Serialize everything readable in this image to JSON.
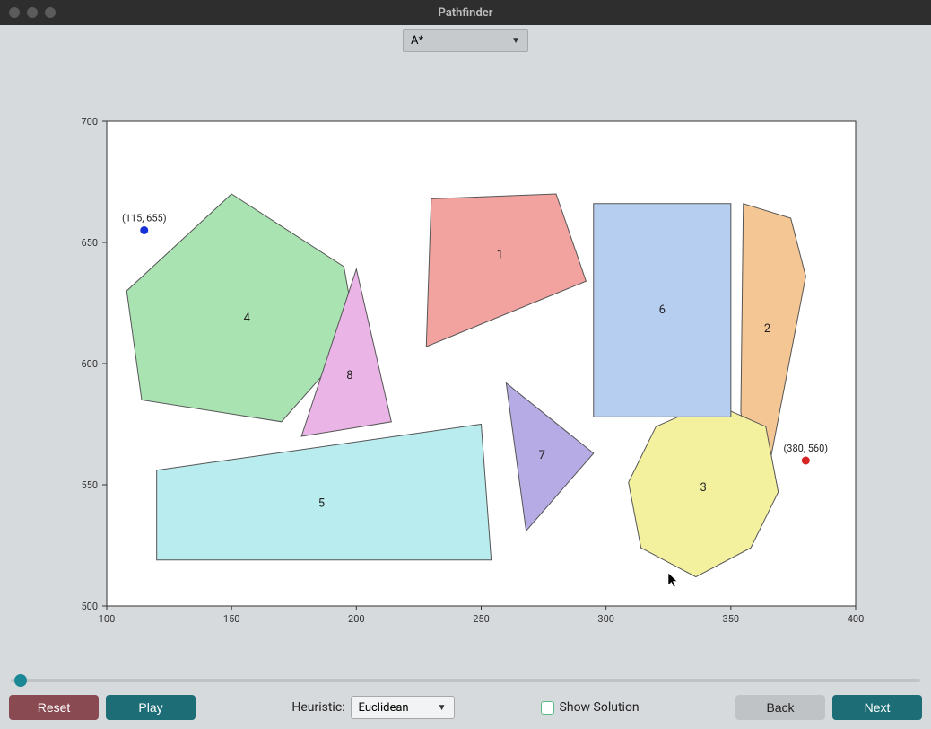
{
  "window": {
    "title": "Pathfinder"
  },
  "toolbar": {
    "algorithm_label": "A*"
  },
  "footer": {
    "reset_label": "Reset",
    "play_label": "Play",
    "heuristic_label": "Heuristic:",
    "heuristic_value": "Euclidean",
    "show_solution_label": "Show Solution",
    "back_label": "Back",
    "next_label": "Next"
  },
  "chart_data": {
    "type": "scatter",
    "xlabel": "",
    "ylabel": "",
    "xlim": [
      100,
      400
    ],
    "ylim": [
      500,
      700
    ],
    "xticks": [
      100,
      150,
      200,
      250,
      300,
      350,
      400
    ],
    "yticks": [
      500,
      550,
      600,
      650,
      700
    ],
    "points": [
      {
        "id": "start",
        "x": 115,
        "y": 655,
        "label": "(115, 655)",
        "color": "#1631d6"
      },
      {
        "id": "goal",
        "x": 380,
        "y": 560,
        "label": "(380, 560)",
        "color": "#d62424"
      }
    ],
    "polygons": [
      {
        "id": "1",
        "label": "1",
        "fill": "#f2a3a0",
        "stroke": "#555",
        "vertices": [
          [
            230,
            668
          ],
          [
            280,
            670
          ],
          [
            292,
            634
          ],
          [
            228,
            607
          ]
        ]
      },
      {
        "id": "2",
        "label": "2",
        "fill": "#f4c694",
        "stroke": "#555",
        "vertices": [
          [
            355,
            666
          ],
          [
            374,
            660
          ],
          [
            380,
            636
          ],
          [
            360,
            529
          ],
          [
            354,
            580
          ]
        ]
      },
      {
        "id": "3",
        "label": "3",
        "fill": "#f3f09e",
        "stroke": "#555",
        "vertices": [
          [
            320,
            574
          ],
          [
            342,
            584
          ],
          [
            364,
            574
          ],
          [
            369,
            547
          ],
          [
            358,
            524
          ],
          [
            336,
            512
          ],
          [
            314,
            524
          ],
          [
            309,
            551
          ]
        ]
      },
      {
        "id": "4",
        "label": "4",
        "fill": "#a9e3b2",
        "stroke": "#555",
        "vertices": [
          [
            150,
            670
          ],
          [
            195,
            640
          ],
          [
            200,
            611
          ],
          [
            170,
            576
          ],
          [
            114,
            585
          ],
          [
            108,
            630
          ]
        ]
      },
      {
        "id": "5",
        "label": "5",
        "fill": "#b8ecee",
        "stroke": "#555",
        "vertices": [
          [
            120,
            556
          ],
          [
            250,
            575
          ],
          [
            254,
            519
          ],
          [
            120,
            519
          ]
        ]
      },
      {
        "id": "6",
        "label": "6",
        "fill": "#b6cef0",
        "stroke": "#555",
        "vertices": [
          [
            295,
            666
          ],
          [
            350,
            666
          ],
          [
            350,
            578
          ],
          [
            295,
            578
          ]
        ]
      },
      {
        "id": "7",
        "label": "7",
        "fill": "#b7abe6",
        "stroke": "#555",
        "vertices": [
          [
            260,
            592
          ],
          [
            295,
            563
          ],
          [
            268,
            531
          ]
        ]
      },
      {
        "id": "8",
        "label": "8",
        "fill": "#eab4e7",
        "stroke": "#555",
        "vertices": [
          [
            200,
            639
          ],
          [
            214,
            576
          ],
          [
            178,
            570
          ]
        ]
      }
    ]
  }
}
